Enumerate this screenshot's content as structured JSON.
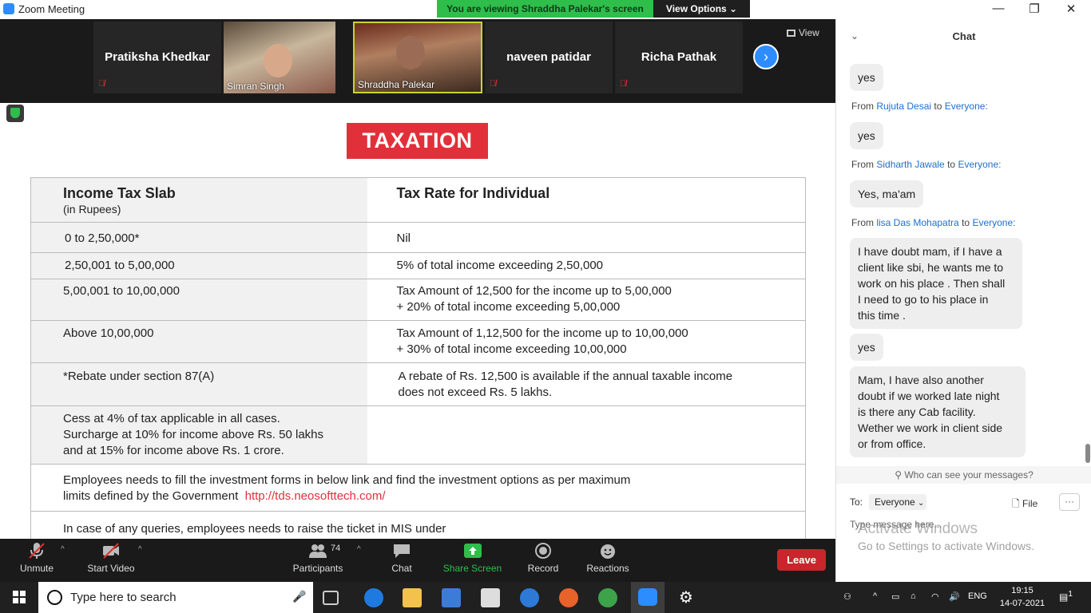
{
  "window": {
    "title": "Zoom Meeting",
    "banner": "You are viewing Shraddha Palekar's screen",
    "view_options": "View Options ⌄",
    "minimize": "—",
    "maximize": "❐",
    "close": "✕"
  },
  "gallery": {
    "participants": [
      {
        "name": "Pratiksha Khedkar",
        "video": false
      },
      {
        "name": "Simran Singh",
        "video": true
      },
      {
        "name": "Shraddha Palekar",
        "video": true
      },
      {
        "name": "naveen patidar",
        "video": false
      },
      {
        "name": "Richa Pathak",
        "video": false
      }
    ],
    "view_label": "View",
    "next_glyph": "›"
  },
  "slide": {
    "title": "TAXATION",
    "header_left": "Income Tax Slab",
    "header_left_sub": "(in Rupees)",
    "header_right": "Tax Rate for Individual",
    "rows": [
      {
        "left": "0 to 2,50,000*",
        "right": "Nil"
      },
      {
        "left": "2,50,001 to 5,00,000",
        "right": "5% of total income exceeding 2,50,000"
      },
      {
        "left": "5,00,001 to 10,00,000",
        "right": "Tax Amount of 12,500 for the income up to 5,00,000",
        "right2": "+ 20% of total income exceeding 5,00,000"
      },
      {
        "left": "Above 10,00,000",
        "right": "Tax Amount of 1,12,500 for the income up to 10,00,000",
        "right2": "+ 30% of total income exceeding 10,00,000"
      },
      {
        "left": "*Rebate under section 87(A)",
        "right": "A rebate of Rs. 12,500 is available if the annual taxable income",
        "right2": "does not exceed Rs. 5 lakhs."
      }
    ],
    "cess_lines": [
      "Cess at 4% of tax applicable in all cases.",
      "Surcharge at 10% for income above Rs. 50 lakhs",
      "and at 15% for income above Rs. 1 crore."
    ],
    "investment_line1": "Employees needs to fill the investment forms in below link and find the investment options as per maximum",
    "investment_line2": "limits defined by the Government",
    "investment_link": "http://tds.neosofttech.com/",
    "queries_line": "In case of any queries, employees needs to raise the ticket in MIS under"
  },
  "toolbar": {
    "unmute": "Unmute",
    "start_video": "Start Video",
    "participants": "Participants",
    "participants_count": "74",
    "chat": "Chat",
    "share_screen": "Share Screen",
    "record": "Record",
    "reactions": "Reactions",
    "leave": "Leave"
  },
  "chat": {
    "title": "Chat",
    "messages": [
      {
        "text": "yes"
      },
      {
        "from": "Rujuta Desai",
        "to": "Everyone:",
        "text": "yes"
      },
      {
        "from": "Sidharth Jawale",
        "to": "Everyone:",
        "text": "Yes, ma'am"
      },
      {
        "from": "lisa Das Mohapatra",
        "to": "Everyone:",
        "lines": [
          "I have doubt mam, if I have a",
          "client like sbi, he wants me to",
          "work on his place . Then shall",
          "I need to go to his place in",
          "this time ."
        ]
      },
      {
        "text": "yes"
      },
      {
        "lines": [
          "Mam, I have also another",
          "doubt if we worked late night",
          "is there any Cab facility.",
          "Wether  we work in client side",
          "or from office."
        ]
      }
    ],
    "from_prefix": "From",
    "to_word": "to",
    "who_can_see": "Who can see your messages?",
    "to_label": "To:",
    "recipient": "Everyone",
    "file": "File",
    "more": "···",
    "placeholder": "Type message here...",
    "activate_title": "Activate Windows",
    "activate_sub": "Go to Settings to activate Windows."
  },
  "taskbar": {
    "search_placeholder": "Type here to search",
    "language": "ENG",
    "time": "19:15",
    "date": "14-07-2021",
    "notification_count": "1"
  },
  "colors": {
    "banner_green": "#2fbe4b",
    "accent_blue": "#2d8cff",
    "taxation_red": "#e2303a",
    "leave_red": "#c8262c"
  }
}
